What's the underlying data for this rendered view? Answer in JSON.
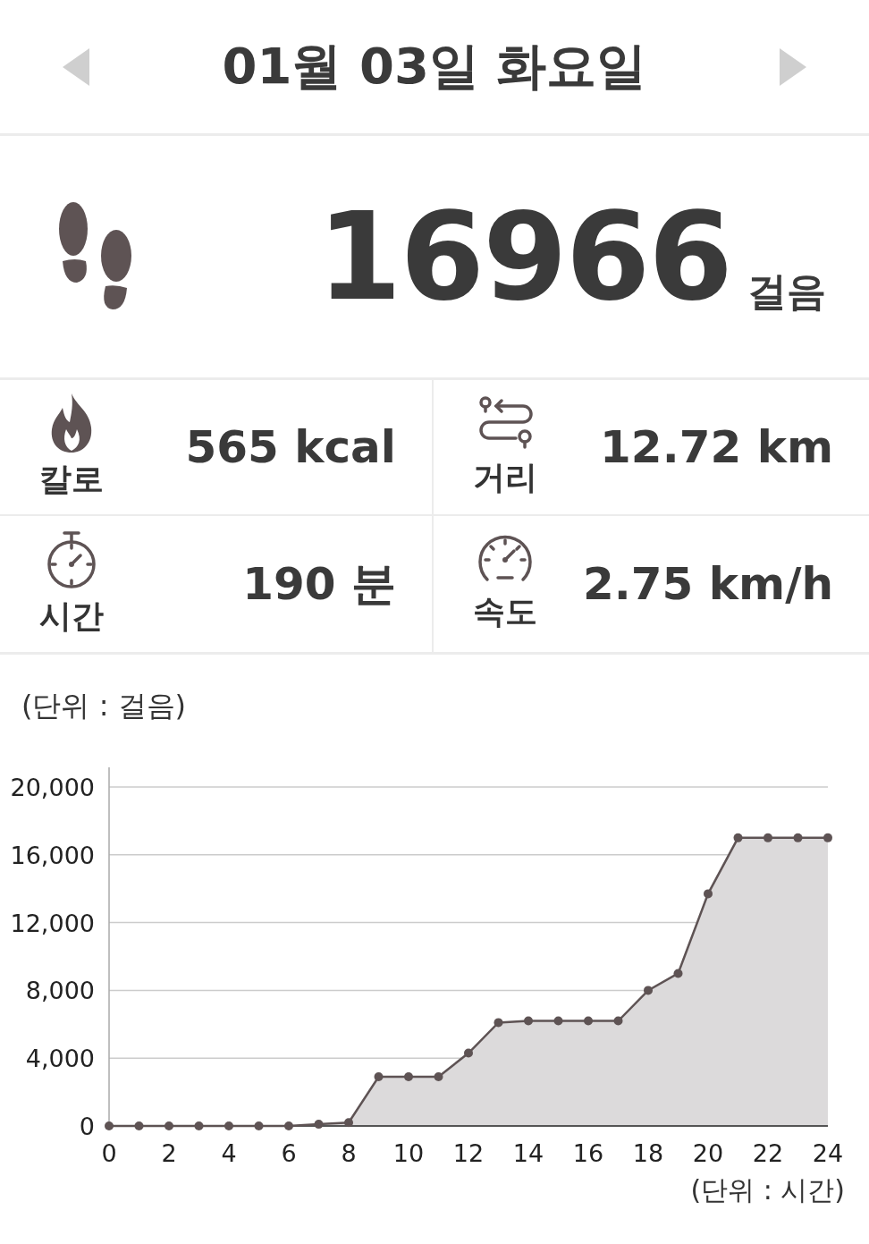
{
  "header": {
    "title": "01월 03일 화요일"
  },
  "steps": {
    "value": "16966",
    "unit": "걸음"
  },
  "stats": [
    {
      "kind": "calories",
      "label": "칼로",
      "value": "565 kcal"
    },
    {
      "kind": "distance",
      "label": "거리",
      "value": "12.72 km"
    },
    {
      "kind": "time",
      "label": "시간",
      "value": "190 분"
    },
    {
      "kind": "speed",
      "label": "속도",
      "value": "2.75 km/h"
    }
  ],
  "chart": {
    "chart_data": {
      "type": "area",
      "ylabel": "(단위 : 걸음)",
      "xlabel": "(단위 : 시간)",
      "x": [
        0,
        1,
        2,
        3,
        4,
        5,
        6,
        7,
        8,
        9,
        10,
        11,
        12,
        13,
        14,
        15,
        16,
        17,
        18,
        19,
        20,
        21,
        22,
        23,
        24
      ],
      "series": [
        {
          "color": "#5e5354",
          "values": [
            0,
            0,
            0,
            0,
            0,
            0,
            0,
            100,
            200,
            2900,
            2900,
            2900,
            4300,
            6100,
            6200,
            6200,
            6200,
            6200,
            8000,
            9000,
            13700,
            17000,
            17000,
            17000,
            17000
          ]
        }
      ],
      "grid": true,
      "xlim": [
        0,
        24
      ],
      "ylim": [
        0,
        20000
      ],
      "xticks": [
        0,
        2,
        4,
        6,
        8,
        10,
        12,
        14,
        16,
        18,
        20,
        22,
        24
      ],
      "yticks": [
        {
          "value": 0,
          "label": "0"
        },
        {
          "value": 4000,
          "label": "4,000"
        },
        {
          "value": 8000,
          "label": "8,000"
        },
        {
          "value": 12000,
          "label": "12,000"
        },
        {
          "value": 16000,
          "label": "16,000"
        },
        {
          "value": 20000,
          "label": "20,000"
        }
      ]
    }
  }
}
